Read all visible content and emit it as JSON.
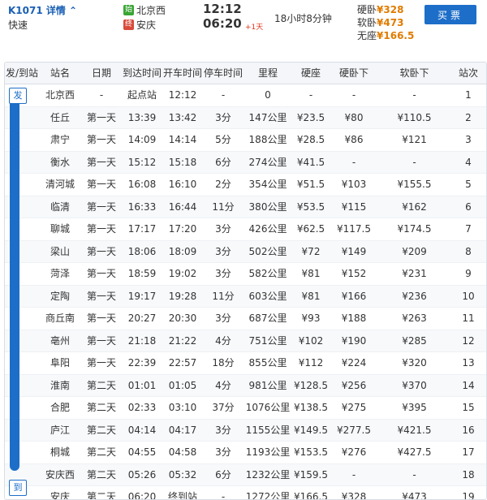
{
  "header": {
    "train_no": "K1071 详情 ⌃",
    "train_type": "快速",
    "from_badge": "始",
    "from_station": "北京西",
    "to_badge": "终",
    "to_station": "安庆",
    "dep_time": "12:12",
    "arr_time": "06:20",
    "plus_day": "+1天",
    "duration": "18小时8分钟",
    "prices": [
      {
        "label": "硬卧",
        "value": "¥328"
      },
      {
        "label": "软卧",
        "value": "¥473"
      },
      {
        "label": "无座",
        "value": "¥166.5"
      }
    ],
    "buy_label": "买票"
  },
  "table": {
    "columns": [
      "发/到站",
      "站名",
      "日期",
      "到达时间",
      "开车时间",
      "停车时间",
      "里程",
      "硬座",
      "硬卧下",
      "软卧下",
      "站次"
    ],
    "side_start": "发",
    "side_end": "到",
    "rows": [
      [
        "北京西",
        "-",
        "起点站",
        "12:12",
        "-",
        "0",
        "-",
        "-",
        "-",
        "1"
      ],
      [
        "任丘",
        "第一天",
        "13:39",
        "13:42",
        "3分",
        "147公里",
        "¥23.5",
        "¥80",
        "¥110.5",
        "2"
      ],
      [
        "肃宁",
        "第一天",
        "14:09",
        "14:14",
        "5分",
        "188公里",
        "¥28.5",
        "¥86",
        "¥121",
        "3"
      ],
      [
        "衡水",
        "第一天",
        "15:12",
        "15:18",
        "6分",
        "274公里",
        "¥41.5",
        "-",
        "-",
        "4"
      ],
      [
        "清河城",
        "第一天",
        "16:08",
        "16:10",
        "2分",
        "354公里",
        "¥51.5",
        "¥103",
        "¥155.5",
        "5"
      ],
      [
        "临清",
        "第一天",
        "16:33",
        "16:44",
        "11分",
        "380公里",
        "¥53.5",
        "¥115",
        "¥162",
        "6"
      ],
      [
        "聊城",
        "第一天",
        "17:17",
        "17:20",
        "3分",
        "426公里",
        "¥62.5",
        "¥117.5",
        "¥174.5",
        "7"
      ],
      [
        "梁山",
        "第一天",
        "18:06",
        "18:09",
        "3分",
        "502公里",
        "¥72",
        "¥149",
        "¥209",
        "8"
      ],
      [
        "菏泽",
        "第一天",
        "18:59",
        "19:02",
        "3分",
        "582公里",
        "¥81",
        "¥152",
        "¥231",
        "9"
      ],
      [
        "定陶",
        "第一天",
        "19:17",
        "19:28",
        "11分",
        "603公里",
        "¥81",
        "¥166",
        "¥236",
        "10"
      ],
      [
        "商丘南",
        "第一天",
        "20:27",
        "20:30",
        "3分",
        "687公里",
        "¥93",
        "¥188",
        "¥263",
        "11"
      ],
      [
        "亳州",
        "第一天",
        "21:18",
        "21:22",
        "4分",
        "751公里",
        "¥102",
        "¥190",
        "¥285",
        "12"
      ],
      [
        "阜阳",
        "第一天",
        "22:39",
        "22:57",
        "18分",
        "855公里",
        "¥112",
        "¥224",
        "¥320",
        "13"
      ],
      [
        "淮南",
        "第二天",
        "01:01",
        "01:05",
        "4分",
        "981公里",
        "¥128.5",
        "¥256",
        "¥370",
        "14"
      ],
      [
        "合肥",
        "第二天",
        "02:33",
        "03:10",
        "37分",
        "1076公里",
        "¥138.5",
        "¥275",
        "¥395",
        "15"
      ],
      [
        "庐江",
        "第二天",
        "04:14",
        "04:17",
        "3分",
        "1155公里",
        "¥149.5",
        "¥277.5",
        "¥421.5",
        "16"
      ],
      [
        "桐城",
        "第二天",
        "04:55",
        "04:58",
        "3分",
        "1193公里",
        "¥153.5",
        "¥276",
        "¥427.5",
        "17"
      ],
      [
        "安庆西",
        "第二天",
        "05:26",
        "05:32",
        "6分",
        "1232公里",
        "¥159.5",
        "-",
        "-",
        "18"
      ],
      [
        "安庆",
        "第二天",
        "06:20",
        "终到站",
        "-",
        "1272公里",
        "¥166.5",
        "¥328",
        "¥473",
        "19"
      ]
    ]
  },
  "colors": {
    "accent": "#1d6ec8",
    "price": "#e07b00",
    "plusday": "#e0351b"
  }
}
